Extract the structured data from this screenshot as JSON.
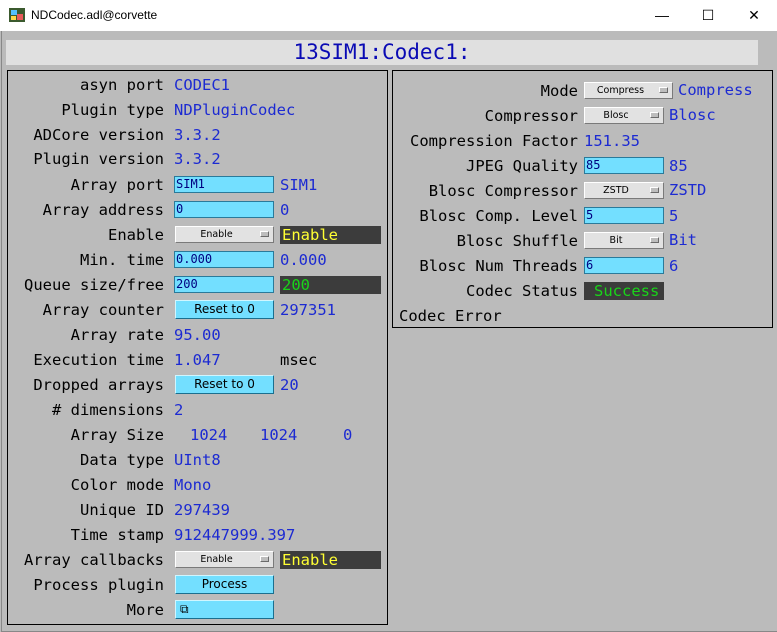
{
  "window": {
    "title": "NDCodec.adl@corvette",
    "minimize": "—",
    "maximize": "☐",
    "close": "✕"
  },
  "header": {
    "title": "13SIM1:Codec1:"
  },
  "left": {
    "asyn_port": {
      "label": "asyn port",
      "value": "CODEC1"
    },
    "plugin_type": {
      "label": "Plugin type",
      "value": "NDPluginCodec"
    },
    "adcore_version": {
      "label": "ADCore version",
      "value": "3.3.2"
    },
    "plugin_version": {
      "label": "Plugin version",
      "value": "3.3.2"
    },
    "array_port": {
      "label": "Array port",
      "input": "SIM1",
      "value": "SIM1"
    },
    "array_address": {
      "label": "Array address",
      "input": "0",
      "value": "0"
    },
    "enable": {
      "label": "Enable",
      "menu": "Enable",
      "status": "Enable"
    },
    "min_time": {
      "label": "Min. time",
      "input": "0.000",
      "value": "0.000"
    },
    "queue_size": {
      "label": "Queue size/free",
      "input": "200",
      "status": "200"
    },
    "array_counter": {
      "label": "Array counter",
      "button": "Reset to 0",
      "value": "297351"
    },
    "array_rate": {
      "label": "Array rate",
      "value": "95.00"
    },
    "execution_time": {
      "label": "Execution time",
      "value": "1.047",
      "unit": "msec"
    },
    "dropped_arrays": {
      "label": "Dropped arrays",
      "button": "Reset to 0",
      "value": "20"
    },
    "dimensions": {
      "label": "# dimensions",
      "value": "2"
    },
    "array_size": {
      "label": "Array Size",
      "v0": "1024",
      "v1": "1024",
      "v2": "0"
    },
    "data_type": {
      "label": "Data type",
      "value": "UInt8"
    },
    "color_mode": {
      "label": "Color mode",
      "value": "Mono"
    },
    "unique_id": {
      "label": "Unique ID",
      "value": "297439"
    },
    "time_stamp": {
      "label": "Time stamp",
      "value": "912447999.397"
    },
    "array_callbacks": {
      "label": "Array callbacks",
      "menu": "Enable",
      "status": "Enable"
    },
    "process_plugin": {
      "label": "Process plugin",
      "button": "Process"
    },
    "more": {
      "label": "More",
      "button": "⧉"
    }
  },
  "right": {
    "mode": {
      "label": "Mode",
      "menu": "Compress",
      "value": "Compress"
    },
    "compressor": {
      "label": "Compressor",
      "menu": "Blosc",
      "value": "Blosc"
    },
    "compression_factor": {
      "label": "Compression Factor",
      "value": "151.35"
    },
    "jpeg_quality": {
      "label": "JPEG Quality",
      "input": "85",
      "value": "85"
    },
    "blosc_compressor": {
      "label": "Blosc Compressor",
      "menu": "ZSTD",
      "value": "ZSTD"
    },
    "blosc_level": {
      "label": "Blosc Comp. Level",
      "input": "5",
      "value": "5"
    },
    "blosc_shuffle": {
      "label": "Blosc Shuffle",
      "menu": "Bit",
      "value": "Bit"
    },
    "blosc_threads": {
      "label": "Blosc Num Threads",
      "input": "6",
      "value": "6"
    },
    "codec_status": {
      "label": "Codec Status",
      "status": "Success"
    },
    "codec_error": {
      "label": "Codec Error"
    }
  },
  "colors": {
    "status_yellow": "#ffff33",
    "status_green": "#19d419",
    "value_blue": "#1c2ad2",
    "button_cyan": "#73dfff"
  }
}
